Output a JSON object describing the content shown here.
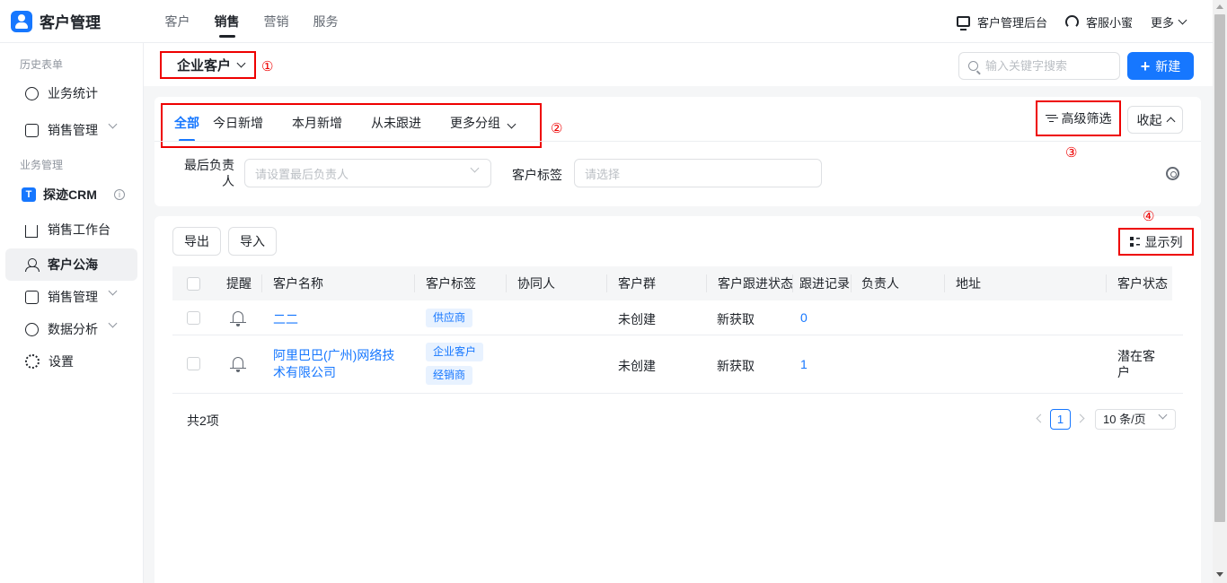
{
  "app": {
    "title": "客户管理",
    "brand_color": "#1677ff"
  },
  "topnav": {
    "items": [
      "客户",
      "销售",
      "营销",
      "服务"
    ],
    "active_index": 1
  },
  "top_right": {
    "admin_label": "客户管理后台",
    "support_label": "客服小蜜",
    "more_label": "更多"
  },
  "sidebar": {
    "section_history": "历史表单",
    "item_business_stats": "业务统计",
    "item_sales_mgmt_1": "销售管理",
    "section_business": "业务管理",
    "crm_label": "探迹CRM",
    "crm_icon_letter": "T",
    "item_workbench": "销售工作台",
    "item_public_pool": "客户公海",
    "item_sales_mgmt_2": "销售管理",
    "item_data_analysis": "数据分析",
    "item_settings": "设置"
  },
  "header": {
    "view_label": "企业客户",
    "search_placeholder": "输入关键字搜索",
    "new_button": "新建"
  },
  "annotations": {
    "a1": "①",
    "a2": "②",
    "a3": "③",
    "a4": "④"
  },
  "filter": {
    "tabs": [
      "全部",
      "今日新增",
      "本月新增",
      "从未跟进",
      "更多分组"
    ],
    "active_tab": 0,
    "advanced_filter": "高级筛选",
    "collapse": "收起",
    "last_owner_label_1": "最后负责",
    "last_owner_label_2": "人",
    "last_owner_placeholder": "请设置最后负责人",
    "tag_label": "客户标签",
    "tag_placeholder": "请选择"
  },
  "toolbar": {
    "export": "导出",
    "import": "导入",
    "columns": "显示列"
  },
  "table": {
    "columns": [
      "提醒",
      "客户名称",
      "客户标签",
      "协同人",
      "客户群",
      "客户跟进状态",
      "跟进记录",
      "负责人",
      "地址",
      "客户状态"
    ],
    "rows": [
      {
        "name_line1": "二二",
        "name_line2": "",
        "tags": [
          "供应商"
        ],
        "group": "未创建",
        "follow_status": "新获取",
        "records": "0",
        "status_line1": "",
        "status_line2": ""
      },
      {
        "name_line1": "阿里巴巴(广州)网络技",
        "name_line2": "术有限公司",
        "tags": [
          "企业客户",
          "经销商"
        ],
        "group": "未创建",
        "follow_status": "新获取",
        "records": "1",
        "status_line1": "潜在客",
        "status_line2": "户"
      }
    ]
  },
  "pagination": {
    "total": "共2项",
    "current_page": "1",
    "page_size": "10 条/页"
  }
}
